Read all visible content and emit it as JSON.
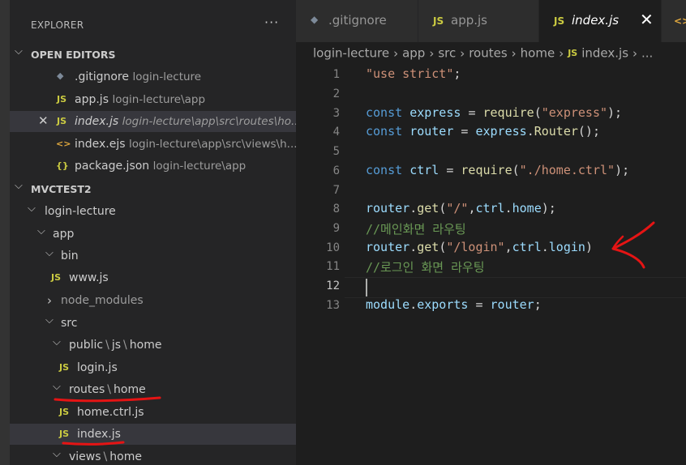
{
  "sidebar": {
    "title": "EXPLORER",
    "more_label": "···",
    "open_editors": {
      "label": "OPEN EDITORS",
      "items": [
        {
          "icon": "◆",
          "name": ".gitignore",
          "desc": "login-lecture"
        },
        {
          "icon": "JS",
          "name": "app.js",
          "desc": "login-lecture\\app"
        },
        {
          "icon": "JS",
          "name": "index.js",
          "desc": "login-lecture\\app\\src\\routes\\ho..."
        },
        {
          "icon": "<>",
          "name": "index.ejs",
          "desc": "login-lecture\\app\\src\\views\\h..."
        },
        {
          "icon": "{}",
          "name": "package.json",
          "desc": "login-lecture\\app"
        }
      ]
    },
    "workspace": {
      "label": "MVCTEST2",
      "tree": {
        "login_lecture": "login-lecture",
        "app": "app",
        "bin": "bin",
        "www": "www.js",
        "node_modules": "node_modules",
        "src": "src",
        "public": "public",
        "public_js": "js",
        "public_home": "home",
        "login_js": "login.js",
        "routes": "routes",
        "routes_home": "home",
        "home_ctrl": "home.ctrl.js",
        "index_js": "index.js",
        "views": "views",
        "views_home": "home"
      }
    }
  },
  "tabs": [
    {
      "icon": "◆",
      "label": ".gitignore"
    },
    {
      "icon": "JS",
      "label": "app.js"
    },
    {
      "icon": "JS",
      "label": "index.js",
      "close": "✕"
    },
    {
      "icon": "<>",
      "label": ""
    }
  ],
  "breadcrumb": {
    "parts": [
      "login-lecture",
      "app",
      "src",
      "routes",
      "home"
    ],
    "file_icon": "JS",
    "file": "index.js",
    "more": "..."
  },
  "editor": {
    "line_numbers": [
      "1",
      "2",
      "3",
      "4",
      "5",
      "6",
      "7",
      "8",
      "9",
      "10",
      "11",
      "12",
      "13"
    ],
    "current_line": "12",
    "tokens": {
      "l1_str": "\"use strict\"",
      "l1_semi": ";",
      "kw_const": "const",
      "l3_var": "express",
      "eq": "=",
      "require": "require",
      "l3_str": "\"express\"",
      "l4_var": "router",
      "l4_obj": "express",
      "l4_router": "Router",
      "l6_var": "ctrl",
      "l6_str": "\"./home.ctrl\"",
      "router": "router",
      "get": "get",
      "l8_str": "\"/\"",
      "ctrl": "ctrl",
      "home": "home",
      "l9_comment": "//메인화면 라우팅",
      "l10_str": "\"/login\"",
      "login": "login",
      "l11_comment": "//로그인 화면 라우팅",
      "module": "module",
      "exports": "exports"
    }
  },
  "colors": {
    "annotation": "#e51414",
    "js_icon": "#cbcb41",
    "keyword": "#569cd6",
    "string": "#ce9178",
    "comment": "#6a9955"
  }
}
